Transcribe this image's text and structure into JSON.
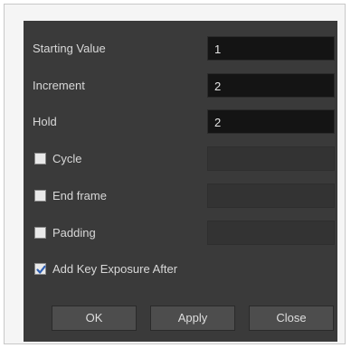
{
  "fields": {
    "starting_value": {
      "label": "Starting Value",
      "value": "1"
    },
    "increment": {
      "label": "Increment",
      "value": "2"
    },
    "hold": {
      "label": "Hold",
      "value": "2"
    }
  },
  "options": {
    "cycle": {
      "label": "Cycle",
      "checked": false,
      "value": ""
    },
    "end_frame": {
      "label": "End frame",
      "checked": false,
      "value": ""
    },
    "padding": {
      "label": "Padding",
      "checked": false,
      "value": ""
    },
    "add_key_exposure_after": {
      "label": "Add Key Exposure After",
      "checked": true
    }
  },
  "buttons": {
    "ok": "OK",
    "apply": "Apply",
    "close": "Close"
  },
  "colors": {
    "dialog_bg": "#3a3a3a",
    "field_bg": "#141414",
    "button_bg": "#4d4d4d",
    "check_mark": "#2f5fb3"
  }
}
